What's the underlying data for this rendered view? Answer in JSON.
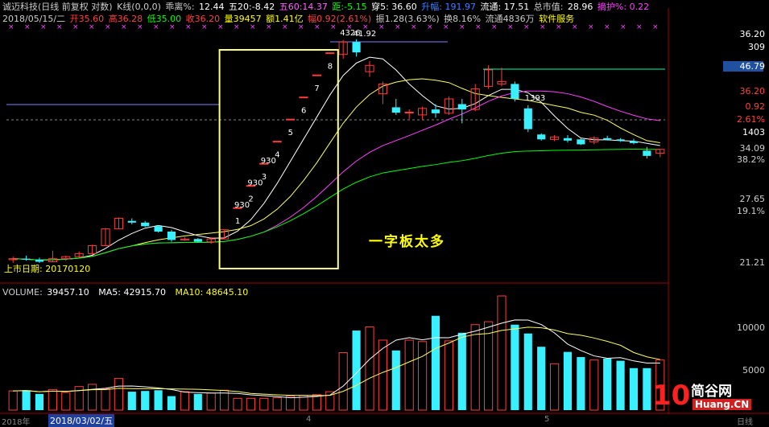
{
  "colors": {
    "up": "#ff3b3b",
    "down": "#38f0ff",
    "ma5": "#ffffff",
    "ma10": "#ffff60",
    "ma20": "#ff40ff",
    "ma60": "#00ff00",
    "text_red": "#ff4040",
    "text_yellow": "#ffff00",
    "text_cyan": "#00ffff",
    "box": "#ffff80"
  },
  "top_bar": {
    "name": "诚迈科技(日线 前复权 对数)",
    "indicator": "K线(0,0,0)",
    "bias_label": "乖离%:",
    "bias_value": "12.44",
    "wu20": "五20:-8.42",
    "wu60": "五60:14.37",
    "ju": "距:-5.15",
    "chuan5": "穿5: 36.60",
    "shengfu": "升幅: 191.97",
    "liutong": "流通: 17.51",
    "zongshizhi_label": "总市值:",
    "zongshizhi": "28.96",
    "zhaohu": "摘护%: 0.22"
  },
  "info_bar": {
    "date": "2018/05/15/二",
    "open": "开35.60",
    "high": "高36.28",
    "low": "低35.00",
    "close": "收36.20",
    "vol": "量39457",
    "amount": "额1.41亿",
    "fu": "幅0.92(2.61%)",
    "zhen": "振1.28(3.63%)",
    "huan": "换8.16%",
    "liutongshares": "流通4836万",
    "sector": "软件服务"
  },
  "price_axis": [
    "36.20",
    "309",
    "46.79",
    "36.20",
    "0.92",
    "2.61%",
    "1403",
    "34.09",
    "38.2%",
    "27.65",
    "19.1%",
    "21.21"
  ],
  "annotation": {
    "text": "一字板太多",
    "ipo": "上市日期: 20170120"
  },
  "board_labels": [
    "1",
    "2",
    "3",
    "4",
    "5",
    "6",
    "7",
    "8"
  ],
  "price_notes": [
    "930",
    "930",
    "930",
    "4326",
    "41.92",
    "1393"
  ],
  "volume_bar": {
    "label": "VOLUME:",
    "value": "39457.10",
    "ma5": "MA5: 42915.70",
    "ma10": "MA10: 48645.10"
  },
  "volume_axis": [
    "10000",
    "5000"
  ],
  "bottom_dates": {
    "year": "2018年",
    "date": "2018/03/02/五",
    "tick4": "4",
    "tick5": "5",
    "mode": "日线"
  },
  "watermark": {
    "logo": "10",
    "brand": "简谷网",
    "site": "Huang.CN"
  },
  "chart_data": {
    "type": "candlestick",
    "candles": [
      [
        22.5,
        22.8,
        22.2,
        22.6
      ],
      [
        22.6,
        22.9,
        22.4,
        22.5
      ],
      [
        22.5,
        22.7,
        22.2,
        22.3
      ],
      [
        22.3,
        23.4,
        22.3,
        22.6
      ],
      [
        22.6,
        22.9,
        22.4,
        22.8
      ],
      [
        22.8,
        23.3,
        22.7,
        23.1
      ],
      [
        23.1,
        24.0,
        23.0,
        23.9
      ],
      [
        23.9,
        25.8,
        23.9,
        25.7
      ],
      [
        25.7,
        27.0,
        25.7,
        26.9
      ],
      [
        26.6,
        26.9,
        26.2,
        26.4
      ],
      [
        26.4,
        26.6,
        25.9,
        26.0
      ],
      [
        26.0,
        26.1,
        25.3,
        25.4
      ],
      [
        25.4,
        25.6,
        24.3,
        24.5
      ],
      [
        24.5,
        24.8,
        24.4,
        24.6
      ],
      [
        24.6,
        24.7,
        24.2,
        24.3
      ],
      [
        24.3,
        24.8,
        24.1,
        24.6
      ],
      [
        24.6,
        25.6,
        24.6,
        25.6
      ],
      [
        28.16,
        28.16,
        28.16,
        28.16
      ],
      [
        30.98,
        30.98,
        30.98,
        30.98
      ],
      [
        34.08,
        34.08,
        34.08,
        34.08
      ],
      [
        37.49,
        37.49,
        37.49,
        37.49
      ],
      [
        41.24,
        41.24,
        41.24,
        41.24
      ],
      [
        45.36,
        45.36,
        45.36,
        45.36
      ],
      [
        49.9,
        49.9,
        49.9,
        49.9
      ],
      [
        54.89,
        54.89,
        54.89,
        54.89
      ],
      [
        54.5,
        58.0,
        53.5,
        57.5
      ],
      [
        57.5,
        58.2,
        54.0,
        55.0
      ],
      [
        50.6,
        53.0,
        49.5,
        52.0
      ],
      [
        46.0,
        48.5,
        44.0,
        48.0
      ],
      [
        43.4,
        45.0,
        42.0,
        42.4
      ],
      [
        42.4,
        43.0,
        41.3,
        42.5
      ],
      [
        42.0,
        43.5,
        41.2,
        43.2
      ],
      [
        43.0,
        44.0,
        41.5,
        42.3
      ],
      [
        42.3,
        45.5,
        42.0,
        45.0
      ],
      [
        44.0,
        45.0,
        40.5,
        43.0
      ],
      [
        43.0,
        48.0,
        42.7,
        47.0
      ],
      [
        47.5,
        52.0,
        47.0,
        51.0
      ],
      [
        48.0,
        51.5,
        47.5,
        48.5
      ],
      [
        48.0,
        48.5,
        44.5,
        45.0
      ],
      [
        43.2,
        43.8,
        39.0,
        39.5
      ],
      [
        38.6,
        38.8,
        37.6,
        37.8
      ],
      [
        37.8,
        38.5,
        37.5,
        38.2
      ],
      [
        38.0,
        38.5,
        37.3,
        37.6
      ],
      [
        37.8,
        38.0,
        36.9,
        37.0
      ],
      [
        37.4,
        38.3,
        37.0,
        38.0
      ],
      [
        38.0,
        38.4,
        37.6,
        37.8
      ],
      [
        37.8,
        38.0,
        37.4,
        37.6
      ],
      [
        37.5,
        37.9,
        37.0,
        37.2
      ],
      [
        36.0,
        36.6,
        34.8,
        35.2
      ],
      [
        35.6,
        36.28,
        35.0,
        36.2
      ]
    ],
    "volumes": [
      2600,
      2700,
      2200,
      2800,
      2400,
      3200,
      3500,
      2900,
      4300,
      2500,
      2600,
      2700,
      1900,
      2500,
      2200,
      2300,
      2700,
      1600,
      1600,
      1600,
      1700,
      1900,
      2000,
      2100,
      2500,
      7800,
      10800,
      11300,
      9500,
      8100,
      9500,
      9300,
      12800,
      9400,
      10500,
      11600,
      12000,
      15500,
      11600,
      10400,
      8600,
      6300,
      7900,
      7200,
      6800,
      7000,
      6700,
      5700,
      5700,
      6800
    ],
    "ma_prices_note": "moving averages are computed from the candle closes in the script",
    "ylim": [
      21.21,
      60.0
    ],
    "vol_ylim": [
      0,
      15500
    ]
  }
}
